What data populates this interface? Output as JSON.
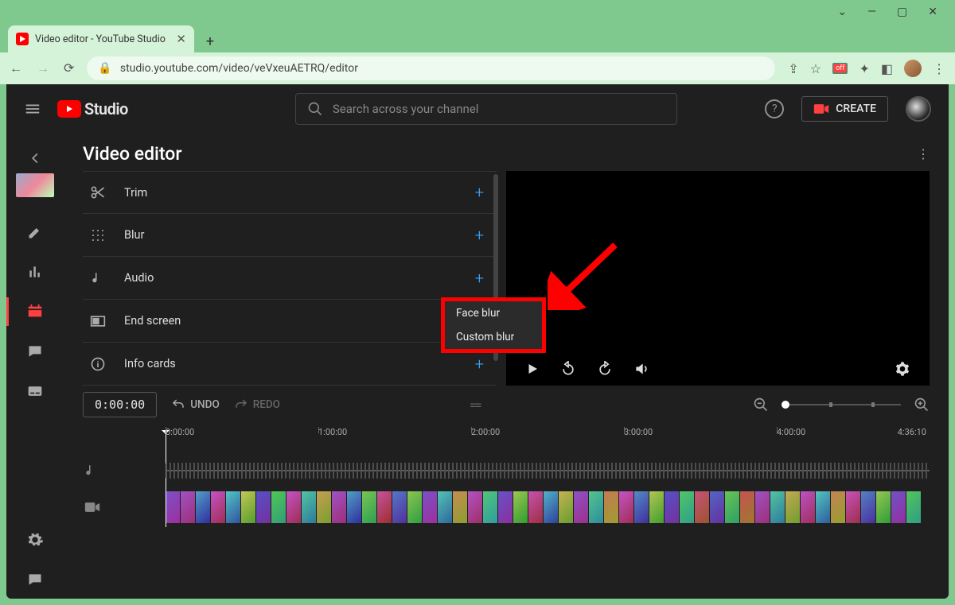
{
  "browser": {
    "tab_title": "Video editor - YouTube Studio",
    "url": "studio.youtube.com/video/veVxeuAETRQ/editor",
    "extension_badge": "off"
  },
  "appbar": {
    "logo_text": "Studio",
    "search_placeholder": "Search across your channel",
    "create_label": "CREATE"
  },
  "page": {
    "title": "Video editor"
  },
  "tools": [
    {
      "icon": "cut",
      "label": "Trim"
    },
    {
      "icon": "grid",
      "label": "Blur"
    },
    {
      "icon": "note",
      "label": "Audio"
    },
    {
      "icon": "rect",
      "label": "End screen"
    },
    {
      "icon": "info",
      "label": "Info cards"
    }
  ],
  "blur_menu": {
    "face": "Face blur",
    "custom": "Custom blur"
  },
  "timeline": {
    "current": "0:00:00",
    "undo": "UNDO",
    "redo": "REDO",
    "marks": [
      "0:00:00",
      "1:00:00",
      "2:00:00",
      "3:00:00",
      "4:00:00"
    ],
    "end": "4:36:10"
  }
}
